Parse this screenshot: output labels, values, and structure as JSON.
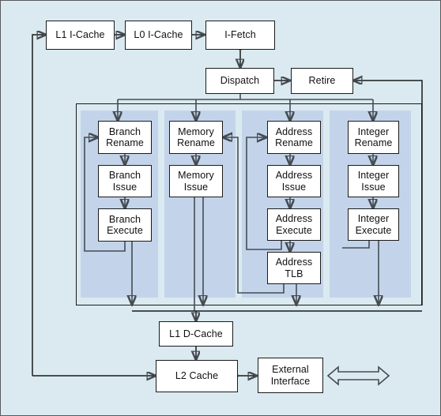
{
  "diagram": {
    "title": "CPU Pipeline Block Diagram",
    "background_color": "#daeaf0",
    "column_color": "#c3d4ea",
    "node_fill": "#ffffff",
    "node_stroke": "#1a1a1a",
    "wire_color": "#454c52"
  },
  "frontend": {
    "l1_icache": "L1 I-Cache",
    "l0_icache": "L0 I-Cache",
    "ifetch": "I-Fetch",
    "dispatch": "Dispatch",
    "retire": "Retire"
  },
  "pipelines": [
    {
      "name": "branch",
      "stages": [
        {
          "line1": "Branch",
          "line2": "Rename"
        },
        {
          "line1": "Branch",
          "line2": "Issue"
        },
        {
          "line1": "Branch",
          "line2": "Execute"
        }
      ]
    },
    {
      "name": "memory",
      "stages": [
        {
          "line1": "Memory",
          "line2": "Rename"
        },
        {
          "line1": "Memory",
          "line2": "Issue"
        }
      ]
    },
    {
      "name": "address",
      "stages": [
        {
          "line1": "Address",
          "line2": "Rename"
        },
        {
          "line1": "Address",
          "line2": "Issue"
        },
        {
          "line1": "Address",
          "line2": "Execute"
        },
        {
          "line1": "Address",
          "line2": "TLB"
        }
      ]
    },
    {
      "name": "integer",
      "stages": [
        {
          "line1": "Integer",
          "line2": "Rename"
        },
        {
          "line1": "Integer",
          "line2": "Issue"
        },
        {
          "line1": "Integer",
          "line2": "Execute"
        }
      ]
    }
  ],
  "memory_system": {
    "l1_dcache": "L1 D-Cache",
    "l2_cache": "L2 Cache",
    "external_interface_line1": "External",
    "external_interface_line2": "Interface",
    "external_bus_icon": "bidirectional-bus-arrow"
  }
}
